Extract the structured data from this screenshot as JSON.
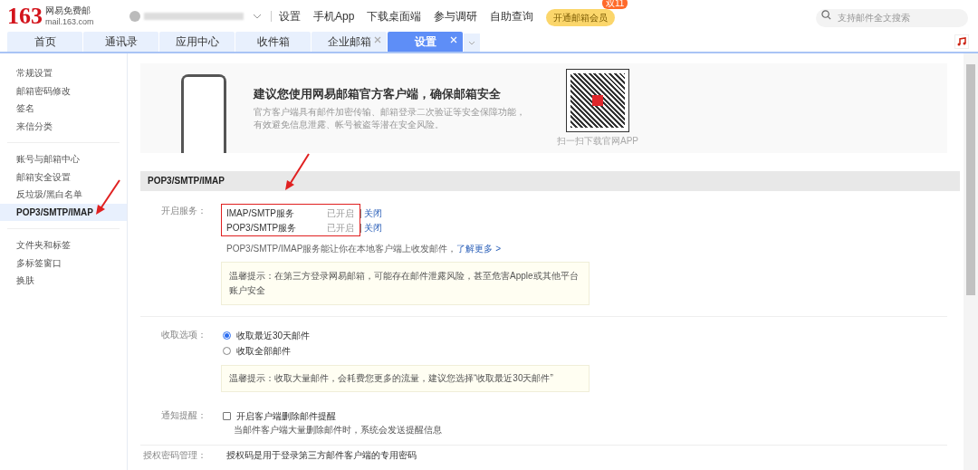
{
  "header": {
    "logo_number": "163",
    "logo_name": "网易免费邮",
    "logo_domain": "mail.163.com",
    "nav": [
      "设置",
      "手机App",
      "下载桌面端",
      "参与调研",
      "自助查询"
    ],
    "vip_button": "开通邮箱会员",
    "vip_badge": "双11",
    "search": {
      "placeholder": "支持邮件全文搜索"
    }
  },
  "tabs": [
    {
      "label": "首页",
      "selected": false,
      "closable": false
    },
    {
      "label": "通讯录",
      "selected": false,
      "closable": false
    },
    {
      "label": "应用中心",
      "selected": false,
      "closable": false
    },
    {
      "label": "收件箱",
      "selected": false,
      "closable": false
    },
    {
      "label": "企业邮箱",
      "selected": false,
      "closable": true
    },
    {
      "label": "设置",
      "selected": true,
      "closable": true
    }
  ],
  "sidebar": {
    "groups": [
      [
        {
          "label": "常规设置",
          "selected": false
        },
        {
          "label": "邮箱密码修改",
          "selected": false
        },
        {
          "label": "签名",
          "selected": false
        },
        {
          "label": "来信分类",
          "selected": false
        }
      ],
      [
        {
          "label": "账号与邮箱中心",
          "selected": false
        },
        {
          "label": "邮箱安全设置",
          "selected": false
        },
        {
          "label": "反垃圾/黑白名单",
          "selected": false
        },
        {
          "label": "POP3/SMTP/IMAP",
          "selected": true
        }
      ],
      [
        {
          "label": "文件夹和标签",
          "selected": false
        },
        {
          "label": "多标签窗口",
          "selected": false
        },
        {
          "label": "换肤",
          "selected": false
        }
      ]
    ]
  },
  "banner": {
    "title": "建议您使用网易邮箱官方客户端，确保邮箱安全",
    "description": "官方客户端具有邮件加密传输、邮箱登录二次验证等安全保障功能，有效避免信息泄露、帐号被盗等潜在安全风险。",
    "qr_caption": "扫一扫下载官网APP"
  },
  "section_title": "POP3/SMTP/IMAP",
  "services": {
    "label": "开启服务：",
    "items": [
      {
        "name": "IMAP/SMTP服务",
        "status": "已开启",
        "action": "关闭"
      },
      {
        "name": "POP3/SMTP服务",
        "status": "已开启",
        "action": "关闭"
      }
    ],
    "description": "POP3/SMTP/IMAP服务能让你在本地客户端上收发邮件，",
    "learn_more": "了解更多 >",
    "tip": "温馨提示：在第三方登录网易邮箱，可能存在邮件泄露风险，甚至危害Apple或其他平台账户安全"
  },
  "fetch": {
    "label": "收取选项：",
    "options": [
      {
        "label": "收取最近30天邮件",
        "selected": true
      },
      {
        "label": "收取全部邮件",
        "selected": false
      }
    ],
    "tip": "温馨提示：收取大量邮件，会耗费您更多的流量，建议您选择“收取最近30天邮件”"
  },
  "notify": {
    "label": "通知提醒：",
    "option": {
      "label": "开启客户端删除邮件提醒",
      "checked": false
    },
    "hint": "当邮件客户端大量删除邮件时，系统会发送提醒信息"
  },
  "auth": {
    "label": "授权密码管理：",
    "text": "授权码是用于登录第三方邮件客户端的专用密码"
  }
}
